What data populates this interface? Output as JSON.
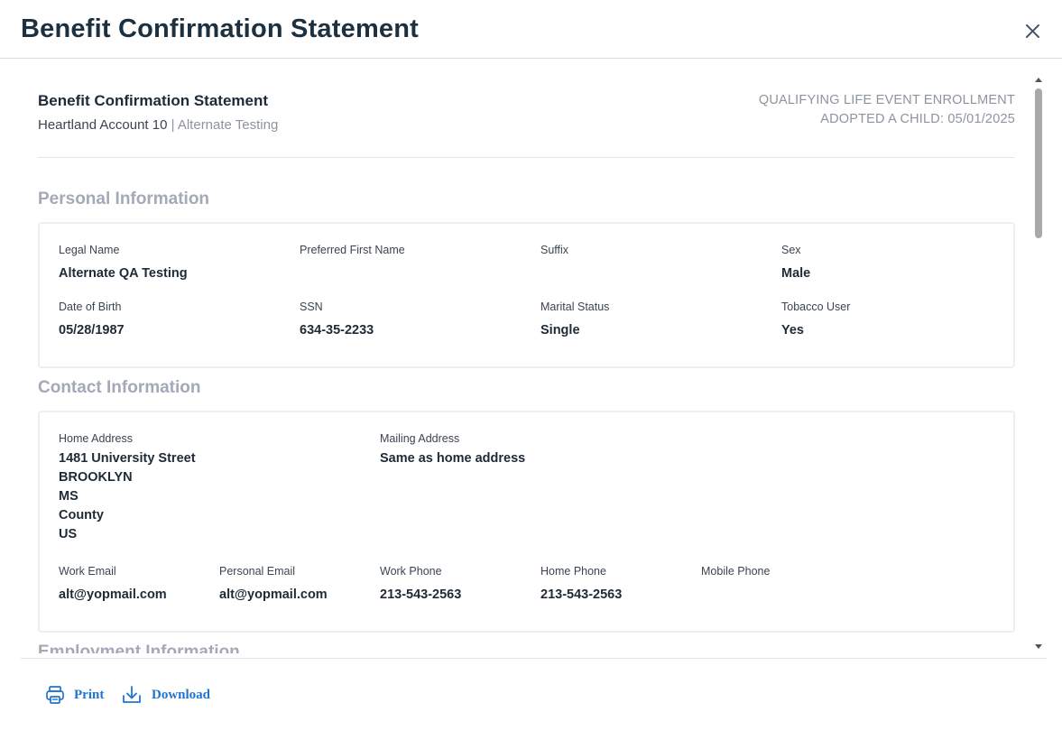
{
  "modal": {
    "title": "Benefit Confirmation Statement"
  },
  "document": {
    "title": "Benefit Confirmation Statement",
    "account": "Heartland Account 10",
    "separator": " | ",
    "employee": "Alternate Testing",
    "event_type": "QUALIFYING LIFE EVENT ENROLLMENT",
    "event_detail": "ADOPTED A CHILD: 05/01/2025"
  },
  "personal": {
    "title": "Personal Information",
    "legal_name": {
      "label": "Legal Name",
      "value": "Alternate QA Testing"
    },
    "preferred_first_name": {
      "label": "Preferred First Name",
      "value": ""
    },
    "suffix": {
      "label": "Suffix",
      "value": ""
    },
    "sex": {
      "label": "Sex",
      "value": "Male"
    },
    "dob": {
      "label": "Date of Birth",
      "value": "05/28/1987"
    },
    "ssn": {
      "label": "SSN",
      "value": "634-35-2233"
    },
    "marital_status": {
      "label": "Marital Status",
      "value": "Single"
    },
    "tobacco_user": {
      "label": "Tobacco User",
      "value": "Yes"
    }
  },
  "contact": {
    "title": "Contact Information",
    "home_address": {
      "label": "Home Address",
      "lines": [
        "1481 University Street",
        "BROOKLYN",
        "MS",
        "County",
        "US"
      ]
    },
    "mailing_address": {
      "label": "Mailing Address",
      "value": "Same as home address"
    },
    "work_email": {
      "label": "Work Email",
      "value": "alt@yopmail.com"
    },
    "personal_email": {
      "label": "Personal Email",
      "value": "alt@yopmail.com"
    },
    "work_phone": {
      "label": "Work Phone",
      "value": "213-543-2563"
    },
    "home_phone": {
      "label": "Home Phone",
      "value": "213-543-2563"
    },
    "mobile_phone": {
      "label": "Mobile Phone",
      "value": ""
    }
  },
  "employment": {
    "title": "Employment Information"
  },
  "footer": {
    "print_label": "Print",
    "download_label": "Download"
  }
}
